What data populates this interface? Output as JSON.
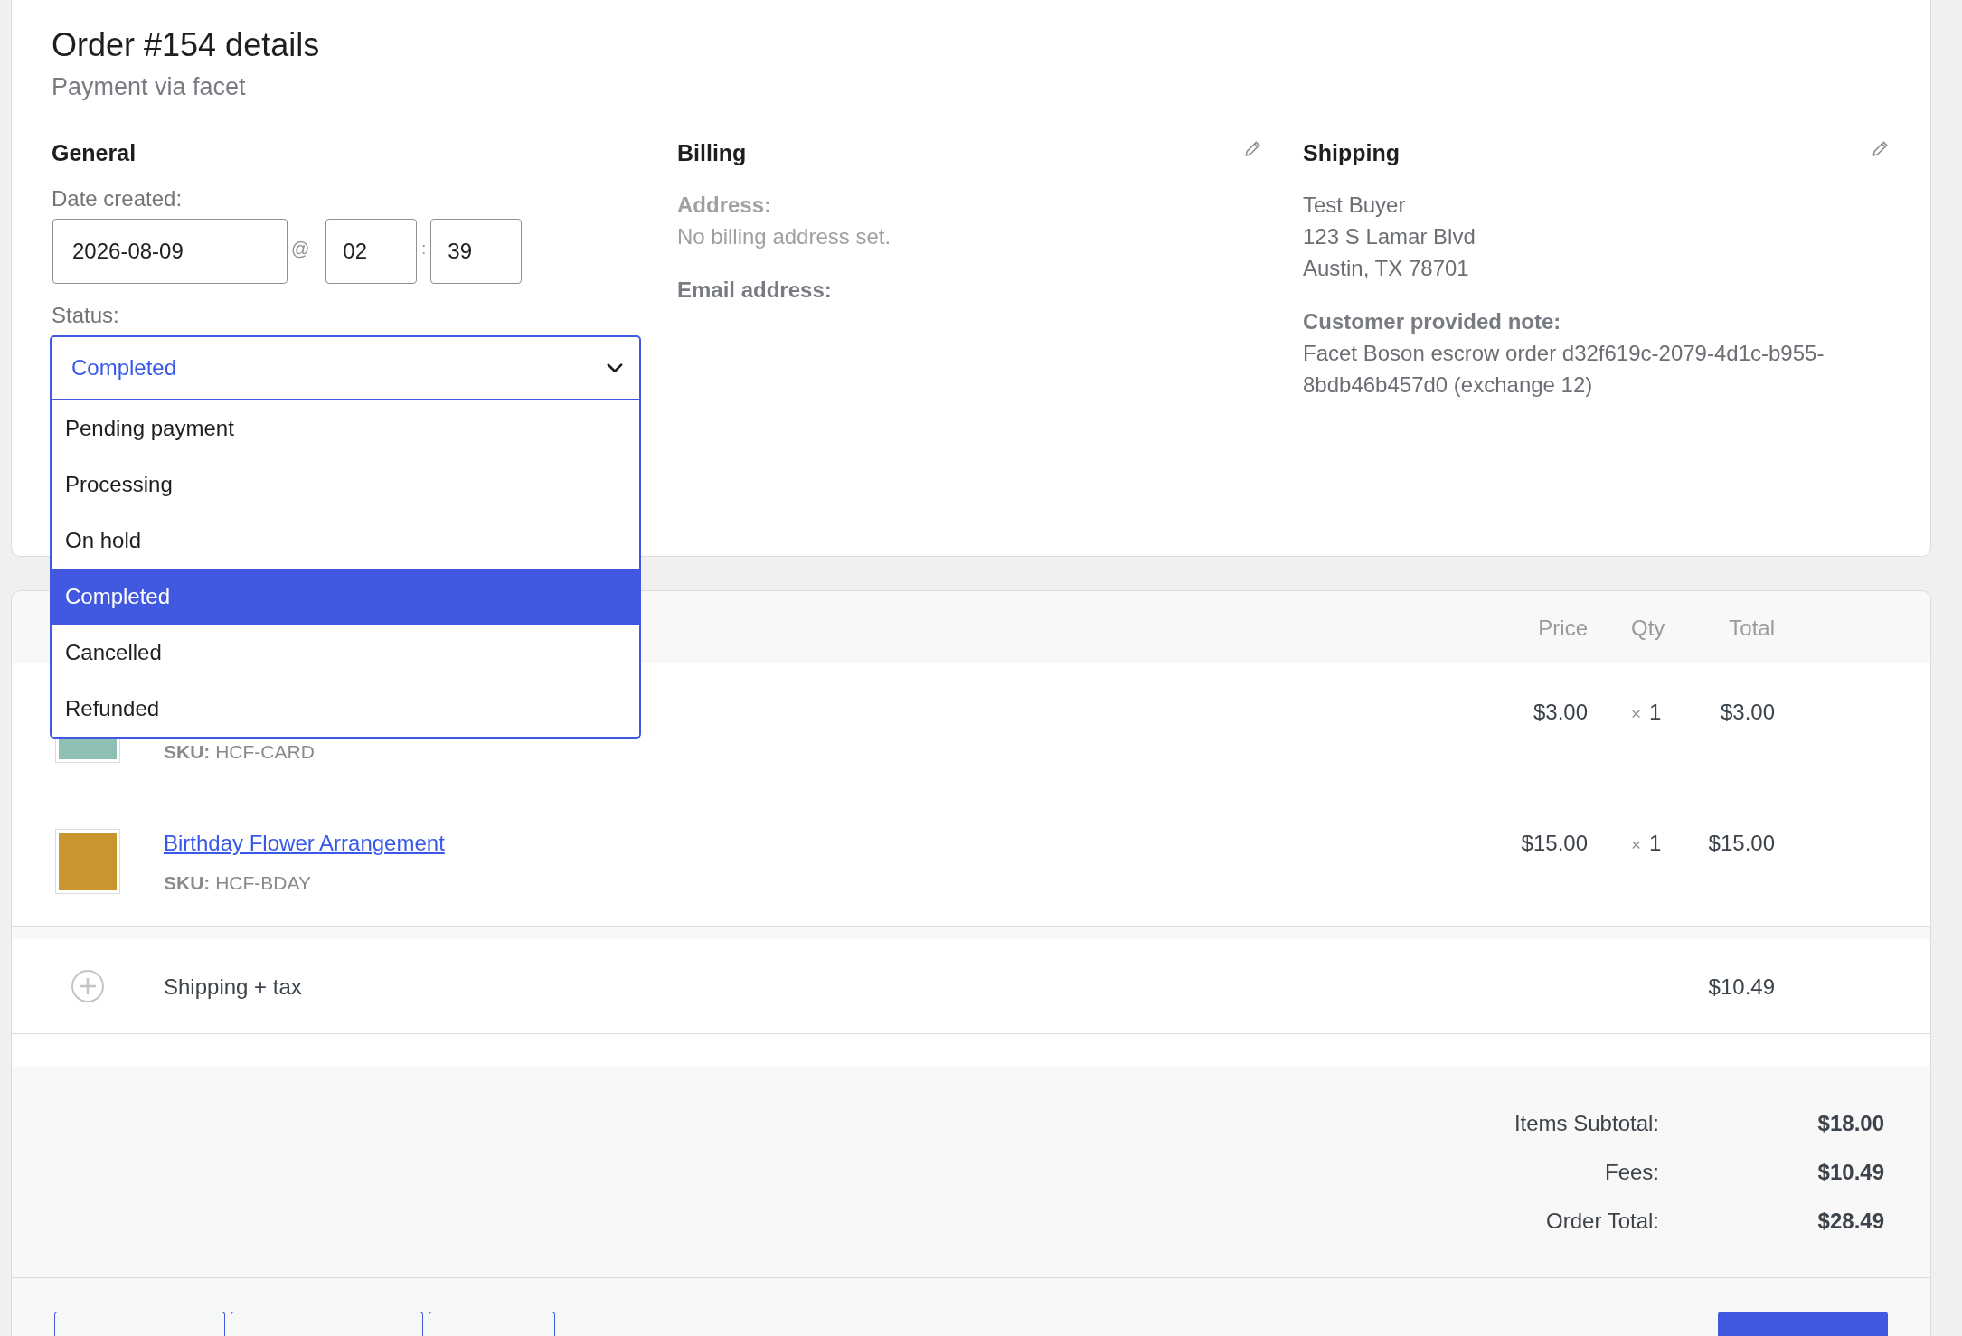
{
  "order": {
    "title": "Order #154 details",
    "subtitle": "Payment via facet"
  },
  "general": {
    "heading": "General",
    "date_label": "Date created:",
    "date": "2026-08-09",
    "at_sign": "@",
    "hour": "02",
    "time_separator": ":",
    "minute": "39",
    "status_label": "Status:",
    "status": {
      "value": "Completed",
      "expanded": true,
      "options": [
        {
          "label": "Pending payment",
          "selected": false
        },
        {
          "label": "Processing",
          "selected": false
        },
        {
          "label": "On hold",
          "selected": false
        },
        {
          "label": "Completed",
          "selected": true
        },
        {
          "label": "Cancelled",
          "selected": false
        },
        {
          "label": "Refunded",
          "selected": false
        }
      ]
    }
  },
  "billing": {
    "heading": "Billing",
    "address_label": "Address:",
    "address": "No billing address set.",
    "email_label": "Email address:"
  },
  "shipping": {
    "heading": "Shipping",
    "address_lines": [
      "Test Buyer",
      "123 S Lamar Blvd",
      "Austin, TX 78701"
    ],
    "note_label": "Customer provided note:",
    "note": "Facet Boson escrow order d32f619c-2079-4d1c-b955-8bdb46b457d0 (exchange 12)"
  },
  "items": {
    "columns": [
      "Price",
      "Qty",
      "Total"
    ],
    "rows": [
      {
        "sku": "**SKU:** HCF-CARD",
        "price": "$3.00",
        "qty_sign": "×",
        "qty": "1",
        "total": "$3.00"
      },
      {
        "name": "Birthday Flower Arrangement",
        "sku": "**SKU:** HCF-BDAY",
        "price": "$15.00",
        "qty_sign": "×",
        "qty": "1",
        "total": "$15.00"
      }
    ]
  },
  "fees": [
    {
      "label": "Shipping + tax",
      "total": "$10.49"
    }
  ],
  "totals": [
    {
      "label": "Items Subtotal:",
      "value": "$18.00"
    },
    {
      "label": "Fees:",
      "value": "$10.49"
    },
    {
      "label": "Order Total:",
      "value": "$28.49"
    }
  ],
  "actions": [
    {
      "kind": "outline"
    },
    {
      "kind": "outline"
    },
    {
      "kind": "outline"
    },
    {
      "kind": "primary"
    }
  ]
}
